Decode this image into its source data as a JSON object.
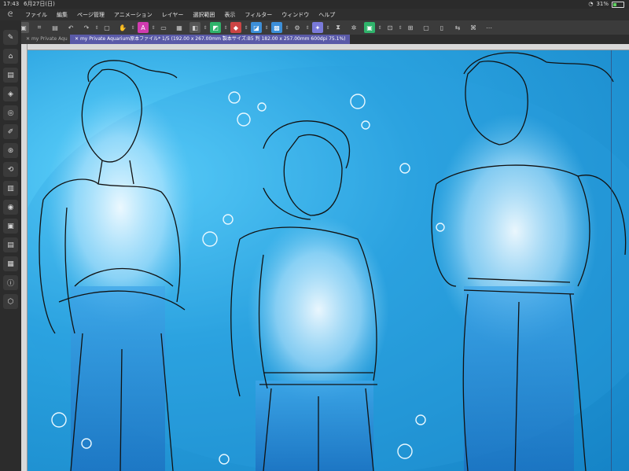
{
  "status": {
    "time": "17:43",
    "date": "6月27日(日)",
    "battery": "31%"
  },
  "menu": {
    "items": [
      "ファイル",
      "編集",
      "ページ管理",
      "アニメーション",
      "レイヤー",
      "選択範囲",
      "表示",
      "フィルター",
      "ウィンドウ",
      "ヘルプ"
    ]
  },
  "tabs": {
    "inactive_label": "my Private Aqu",
    "active_label": "my Private Aquarium原本ファイル* 1/5 (192.00 x 267.00mm 製本サイズ:B5 判 182.00 x 257.00mm 600dpi 75.1%)"
  },
  "toolbar": {
    "icons": [
      "menu-icon",
      "open-icon",
      "save-icon",
      "undo-icon",
      "redo-icon",
      "transform-icon",
      "select-icon",
      "hand-icon",
      "pen-icon",
      "text-icon",
      "layer-icon",
      "color-icon",
      "brush-icon",
      "fill-icon",
      "eraser-icon",
      "filter-icon",
      "gradient-icon",
      "settings-icon",
      "preview-icon",
      "window-icon",
      "tablet-icon",
      "export-icon",
      "shortcut-icon"
    ]
  },
  "sidebar": {
    "icons": [
      "pen-tool-icon",
      "brush-tool-icon",
      "eraser-tool-icon",
      "layer-panel-icon",
      "navigator-icon",
      "color-wheel-icon",
      "material-icon",
      "history-icon",
      "sub-tool-icon",
      "color-set-icon",
      "layer-property-icon",
      "folder-icon",
      "animation-icon",
      "info-icon",
      "auto-action-icon"
    ]
  },
  "colors": {
    "accent_tab": "#5a5aa8",
    "canvas_blue": "#1583c6"
  }
}
